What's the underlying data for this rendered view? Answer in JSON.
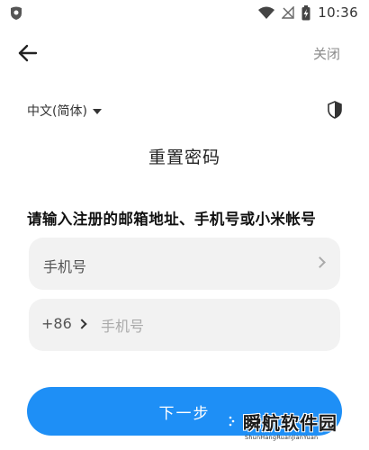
{
  "status_bar": {
    "time": "10:36",
    "icons": [
      "app-shield-icon",
      "wifi-icon",
      "no-signal-icon",
      "battery-charging-icon"
    ]
  },
  "header": {
    "back_icon": "back-arrow-icon",
    "close_label": "关闭"
  },
  "language": {
    "selected": "中文(简体)",
    "dropdown_icon": "caret-down-icon",
    "security_icon": "shield-icon"
  },
  "page_title": "重置密码",
  "instruction": "请输入注册的邮箱地址、手机号或小米帐号",
  "account_type_field": {
    "label": "手机号",
    "icon": "chevron-right-icon"
  },
  "phone_field": {
    "country_code": "+86",
    "placeholder": "手机号",
    "value": ""
  },
  "next_button": {
    "label": "下一步"
  },
  "watermark": {
    "title": "瞬航软件园",
    "subtitle": "ShunHangRuanJianYuan"
  },
  "colors": {
    "accent": "#1e8ff6",
    "field_bg": "#f2f2f2",
    "muted_text": "#8a8a8a"
  }
}
